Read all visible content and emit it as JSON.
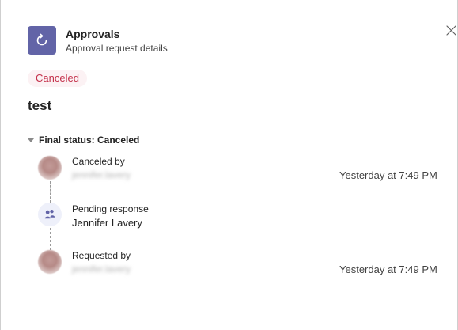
{
  "app": {
    "title": "Approvals",
    "subtitle": "Approval request details",
    "icon": "approvals-icon",
    "icon_color": "#6264a7"
  },
  "close_icon": "close-icon",
  "status_badge": {
    "label": "Canceled",
    "text_color": "#c4314b",
    "background": "#fcf2f4"
  },
  "request": {
    "title": "test"
  },
  "final_status": {
    "label": "Final status: Canceled"
  },
  "timeline": [
    {
      "label": "Canceled by",
      "name": "jennifer.lavery",
      "timestamp": "Yesterday at 7:49 PM"
    },
    {
      "label": "Pending response",
      "name": "Jennifer Lavery",
      "timestamp": ""
    },
    {
      "label": "Requested by",
      "name": "jennifer.lavery",
      "timestamp": "Yesterday at 7:49 PM"
    }
  ]
}
